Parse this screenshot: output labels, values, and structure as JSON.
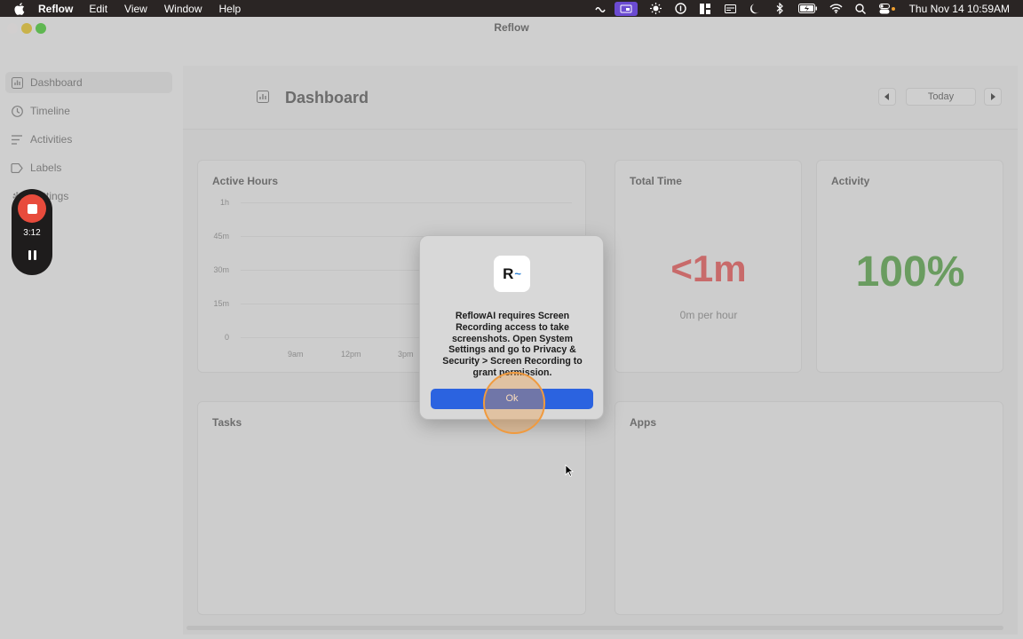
{
  "menubar": {
    "app_name": "Reflow",
    "items": [
      "Edit",
      "View",
      "Window",
      "Help"
    ],
    "clock": "Thu Nov 14  10:59AM"
  },
  "window": {
    "title": "Reflow"
  },
  "sidebar": {
    "items": [
      {
        "label": "Dashboard",
        "icon": "chart-icon",
        "active": true
      },
      {
        "label": "Timeline",
        "icon": "clock-icon"
      },
      {
        "label": "Activities",
        "icon": "list-icon"
      },
      {
        "label": "Labels",
        "icon": "tag-icon"
      },
      {
        "label": "Settings",
        "icon": "gear-icon"
      }
    ]
  },
  "recorder": {
    "time": "3:12"
  },
  "header": {
    "title": "Dashboard",
    "today_label": "Today"
  },
  "cards": {
    "active_hours": {
      "title": "Active Hours"
    },
    "total_time": {
      "title": "Total Time",
      "value": "<1m",
      "subtitle": "0m per hour"
    },
    "activity": {
      "title": "Activity",
      "value": "100%"
    },
    "tasks": {
      "title": "Tasks"
    },
    "apps": {
      "title": "Apps"
    }
  },
  "chart_data": {
    "type": "bar",
    "title": "Active Hours",
    "y_ticks": [
      "1h",
      "45m",
      "30m",
      "15m",
      "0"
    ],
    "x_ticks": [
      "9am",
      "12pm",
      "3pm"
    ],
    "series": []
  },
  "dialog": {
    "icon_text": "R",
    "icon_tilde": "~",
    "message": "ReflowAI requires Screen Recording access to take screenshots. Open System Settings and go to Privacy & Security > Screen Recording to grant permission.",
    "ok_label": "Ok"
  },
  "colors": {
    "accent": "#2b63e0",
    "total_time": "#c86a6a",
    "activity": "#6a9c60",
    "record": "#e84b3c"
  }
}
